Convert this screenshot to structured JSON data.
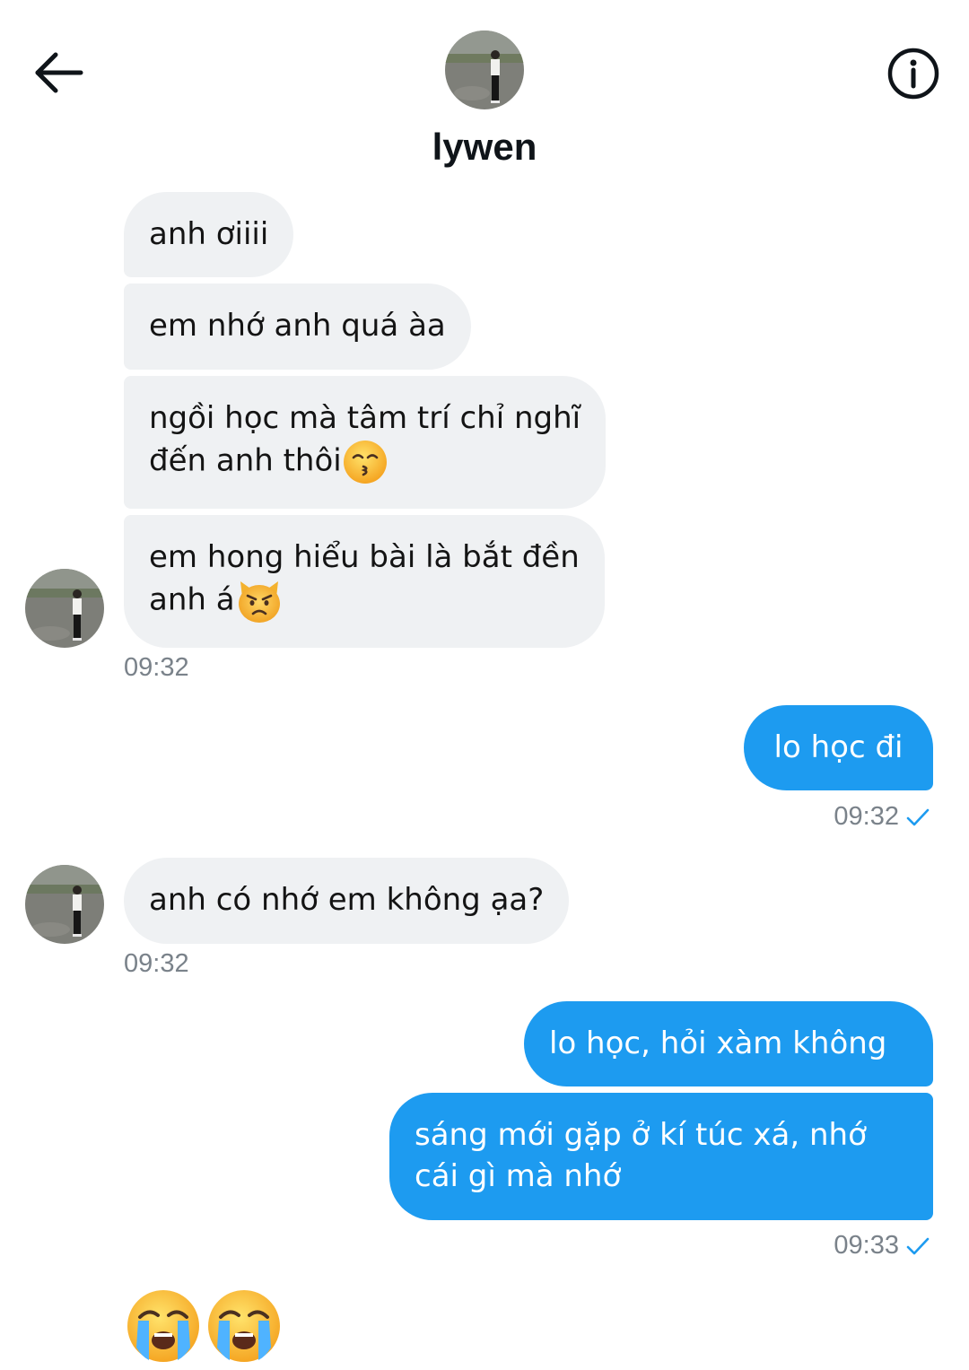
{
  "header": {
    "contact_name": "lywen",
    "back_icon": "arrow-left-icon",
    "info_icon": "info-icon"
  },
  "colors": {
    "incoming_bubble": "#eff1f3",
    "outgoing_bubble": "#1d9bf0",
    "timestamp": "#7a828a",
    "read_check": "#1d9bf0"
  },
  "messages": {
    "m1": {
      "text": "anh ơiiii",
      "direction": "incoming"
    },
    "m2": {
      "text": "em nhớ anh quá àa",
      "direction": "incoming"
    },
    "m3": {
      "line1": "ngồi học mà tâm trí chỉ nghĩ",
      "line2": "đến anh thôi",
      "emoji": "kissing-face-with-smiling-eyes-icon",
      "direction": "incoming"
    },
    "m4": {
      "line1": "em hong hiểu bài là bắt đền",
      "line2": "anh á",
      "emoji": "pouting-cat-icon",
      "direction": "incoming"
    },
    "t1": "09:32",
    "m5": {
      "text": "lo học đi",
      "direction": "outgoing"
    },
    "t2": "09:32",
    "m6": {
      "text": "anh có nhớ em không ạa?",
      "direction": "incoming"
    },
    "t3": "09:32",
    "m7": {
      "text": "lo học, hỏi xàm không",
      "direction": "outgoing"
    },
    "m8": {
      "line1": "sáng mới gặp ở kí túc xá, nhớ",
      "line2": "cái gì mà nhớ",
      "direction": "outgoing"
    },
    "t4": "09:33",
    "m9": {
      "emojis": [
        "loudly-crying-face-icon",
        "loudly-crying-face-icon"
      ],
      "direction": "incoming"
    }
  }
}
